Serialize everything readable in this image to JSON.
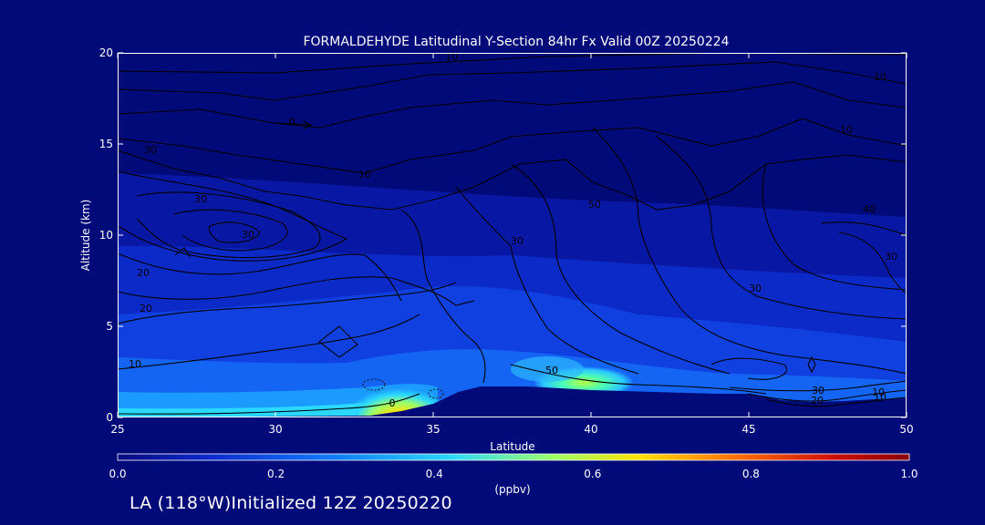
{
  "chart_data": {
    "type": "heatmap",
    "title": "FORMALDEHYDE Latitudinal Y-Section 84hr  Fx Valid 00Z 20250224",
    "xlabel": "Latitude",
    "ylabel": "Altitude (km)",
    "xlim": [
      25,
      50
    ],
    "ylim": [
      0,
      20
    ],
    "x_ticks": [
      25,
      30,
      35,
      40,
      45,
      50
    ],
    "y_ticks": [
      0,
      5,
      10,
      15,
      20
    ],
    "grid": false,
    "colorbar": {
      "min": 0.0,
      "max": 1.0,
      "ticks": [
        "0.0",
        "0.2",
        "0.4",
        "0.6",
        "0.8",
        "1.0"
      ],
      "label": "(ppbv)",
      "colors": [
        "#0a0a80",
        "#0d2bd0",
        "#1080ff",
        "#2bd8ff",
        "#9cff6a",
        "#ffe000",
        "#ff7000",
        "#d01000",
        "#8a0000"
      ]
    },
    "surface_terrain_km": {
      "lat": [
        25,
        33,
        34,
        35,
        35.8,
        36.5,
        38,
        40,
        42,
        44,
        45,
        46,
        47,
        48,
        49,
        50
      ],
      "alt": [
        0,
        0.1,
        0.35,
        0.75,
        1.4,
        1.7,
        1.7,
        1.5,
        1.4,
        1.3,
        1.3,
        0.95,
        0.85,
        0.9,
        1.0,
        1.05
      ]
    },
    "formaldehyde_ppbv_profile": [
      {
        "lat": 34.0,
        "alt_km": 0.5,
        "value": 0.65
      },
      {
        "lat": 33.5,
        "alt_km": 0.3,
        "value": 0.5
      },
      {
        "lat": 32.0,
        "alt_km": 0.2,
        "value": 0.45
      },
      {
        "lat": 30.0,
        "alt_km": 0.1,
        "value": 0.4
      },
      {
        "lat": 40.0,
        "alt_km": 1.8,
        "value": 0.48
      },
      {
        "lat": 28.0,
        "alt_km": 2.5,
        "value": 0.25
      },
      {
        "lat": 37.0,
        "alt_km": 7.0,
        "value": 0.2
      },
      {
        "lat": 27.0,
        "alt_km": 12.0,
        "value": 0.1
      }
    ],
    "contour_labels": [
      "10",
      "10",
      "30",
      "10",
      "30",
      "30",
      "50",
      "40",
      "30",
      "20",
      "20",
      "10",
      "0",
      "0",
      "30",
      "10",
      "30",
      "50",
      "30",
      "20",
      "10",
      "10"
    ],
    "footer": "LA (118°W)Initialized 12Z 20250220"
  }
}
